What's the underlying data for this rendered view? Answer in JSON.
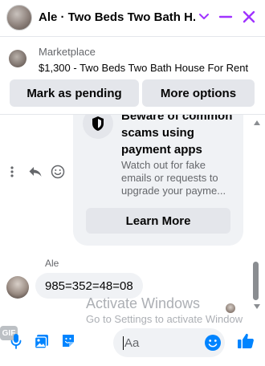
{
  "header": {
    "title": "Ale · Two Beds Two Bath H...",
    "avatar_icon": "profile-avatar",
    "chevron_icon": "chevron-down-icon",
    "minimize_icon": "minus-icon",
    "close_icon": "close-icon",
    "accent_color": "#a033ff"
  },
  "marketplace": {
    "label": "Marketplace",
    "listing": "$1,300 - Two Beds Two Bath House For Rent",
    "mark_pending_label": "Mark as pending",
    "more_options_label": "More options"
  },
  "card": {
    "icon": "shield-icon",
    "title": "Beware of common scams using payment apps",
    "body": "Watch out for fake emails or requests to upgrade your payme...",
    "button_label": "Learn More"
  },
  "message_actions": {
    "more_icon": "more-vertical-icon",
    "reply_icon": "reply-icon",
    "react_icon": "smiley-icon"
  },
  "incoming": {
    "sender": "Ale",
    "text": "985=352=48=08"
  },
  "watermark": {
    "title": "Activate Windows",
    "subtitle": "Go to Settings to activate Window"
  },
  "composer": {
    "mic_icon": "microphone-icon",
    "photo_icon": "photo-icon",
    "sticker_icon": "sticker-icon",
    "gif_label": "GIF",
    "placeholder": "Aa",
    "emoji_icon": "emoji-icon",
    "like_icon": "thumbs-up-icon",
    "accent_color": "#0084ff"
  }
}
